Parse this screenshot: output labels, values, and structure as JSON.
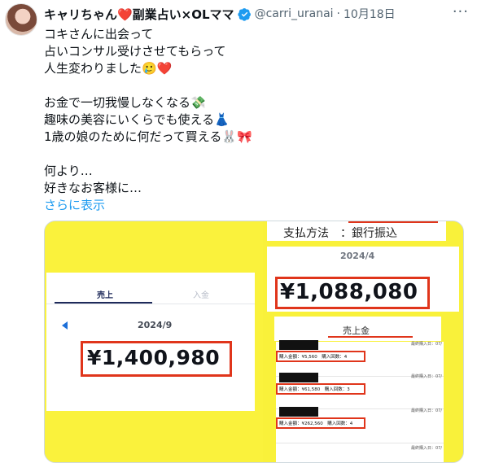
{
  "tweet": {
    "author_name": "キャリちゃん❤️副業占い×OLママ",
    "handle": "@carri_uranai",
    "separator": "·",
    "date": "10月18日",
    "more": "···",
    "lines": [
      "コキさんに出会って",
      "占いコンサル受けさせてもらって",
      "人生変わりました🥲❤️",
      "",
      "お金で一切我慢しなくなる💸",
      "趣味の美容にいくらでも使える👗",
      "1歳の娘のために何だって買える🐰🎀",
      "",
      "何より…",
      "好きなお客様に…"
    ],
    "show_more": "さらに表示"
  },
  "media": {
    "left": {
      "tab_sales": "売上",
      "tab_deposit": "入金",
      "period": "2024/9",
      "amount": "¥1,400,980"
    },
    "right": {
      "payment_label": "支払方法　：銀行振込",
      "period": "2024/4",
      "amount": "¥1,088,080",
      "sales_tab": "売上金",
      "records": [
        {
          "date": "最終購入日：07/",
          "line": "購入金額：¥5,560　購入回数：4"
        },
        {
          "date": "最終購入日：07/",
          "line": "購入金額：¥61,580　購入回数：3"
        },
        {
          "date": "最終購入日：07/",
          "line": "購入金額：¥262,560　購入回数：4"
        }
      ],
      "last_date": "最終購入日：07/"
    }
  },
  "colors": {
    "accent": "#1d9bf0",
    "highlight_yellow": "#f9f13a",
    "frame_red": "#e0351b",
    "verified": "#1d9bf0"
  }
}
